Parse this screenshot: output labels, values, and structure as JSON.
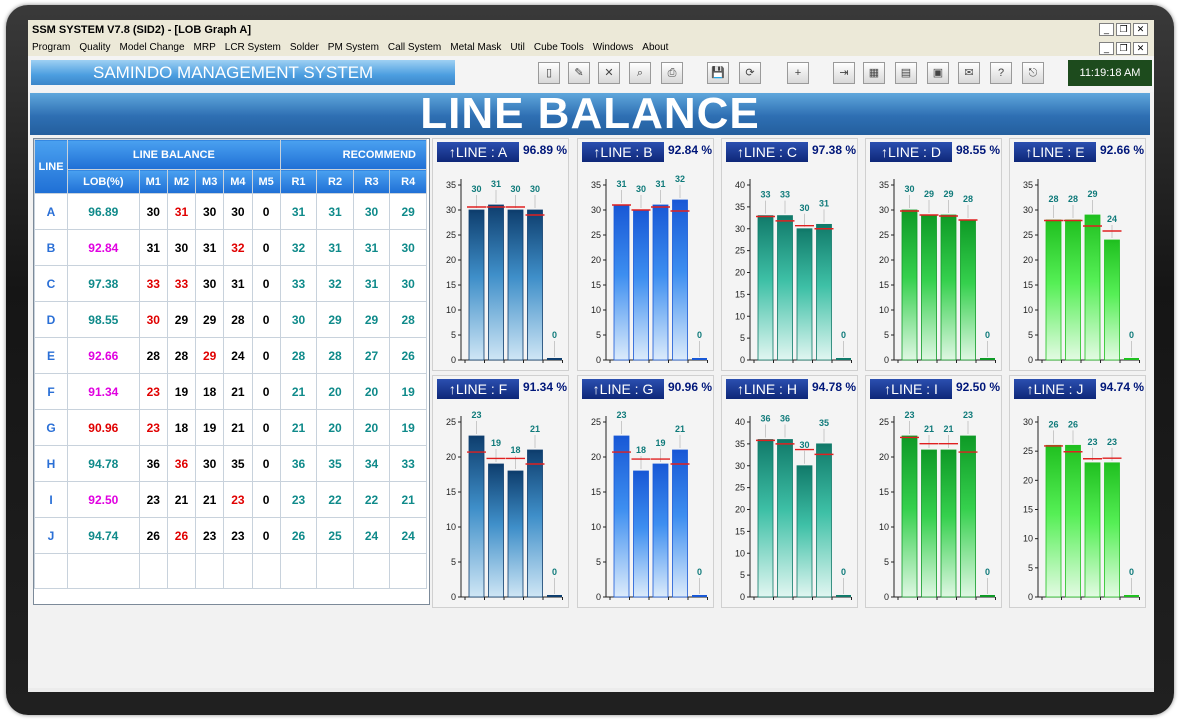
{
  "app": {
    "title": "SSM SYSTEM V7.8 (SID2) - [LOB Graph A]",
    "menu": [
      "Program",
      "Quality",
      "Model Change",
      "MRP",
      "LCR System",
      "Solder",
      "PM System",
      "Call System",
      "Metal Mask",
      "Util",
      "Cube Tools",
      "Windows",
      "About"
    ],
    "system_name": "SAMINDO MANAGEMENT SYSTEM",
    "clock": "11:19:18 AM",
    "page_title": "LINE BALANCE",
    "toolbar_icons": [
      "new-doc-icon",
      "edit-doc-icon",
      "delete-doc-icon",
      "preview-icon",
      "print-icon",
      "save-icon",
      "refresh-icon",
      "add-icon",
      "export-icon",
      "grid-icon",
      "calc-icon",
      "calendar-icon",
      "mail-icon",
      "help-icon",
      "exit-icon"
    ]
  },
  "table": {
    "line_header": "LINE",
    "group_balance": "LINE BALANCE",
    "group_recommend": "RECOMMEND",
    "columns": [
      "LOB(%)",
      "M1",
      "M2",
      "M3",
      "M4",
      "M5",
      "R1",
      "R2",
      "R3",
      "R4"
    ],
    "rows": [
      {
        "line": "A",
        "lob": "96.89",
        "lob_color": "#0f8a8a",
        "m": [
          "30",
          "31",
          "30",
          "30",
          "0"
        ],
        "m_red": [
          false,
          true,
          false,
          false,
          false
        ],
        "r": [
          "31",
          "31",
          "30",
          "29"
        ]
      },
      {
        "line": "B",
        "lob": "92.84",
        "lob_color": "#e000e0",
        "m": [
          "31",
          "30",
          "31",
          "32",
          "0"
        ],
        "m_red": [
          false,
          false,
          false,
          true,
          false
        ],
        "r": [
          "32",
          "31",
          "31",
          "30"
        ]
      },
      {
        "line": "C",
        "lob": "97.38",
        "lob_color": "#0f8a8a",
        "m": [
          "33",
          "33",
          "30",
          "31",
          "0"
        ],
        "m_red": [
          true,
          true,
          false,
          false,
          false
        ],
        "r": [
          "33",
          "32",
          "31",
          "30"
        ]
      },
      {
        "line": "D",
        "lob": "98.55",
        "lob_color": "#0f8a8a",
        "m": [
          "30",
          "29",
          "29",
          "28",
          "0"
        ],
        "m_red": [
          true,
          false,
          false,
          false,
          false
        ],
        "r": [
          "30",
          "29",
          "29",
          "28"
        ]
      },
      {
        "line": "E",
        "lob": "92.66",
        "lob_color": "#e000e0",
        "m": [
          "28",
          "28",
          "29",
          "24",
          "0"
        ],
        "m_red": [
          false,
          false,
          true,
          false,
          false
        ],
        "r": [
          "28",
          "28",
          "27",
          "26"
        ]
      },
      {
        "line": "F",
        "lob": "91.34",
        "lob_color": "#e000e0",
        "m": [
          "23",
          "19",
          "18",
          "21",
          "0"
        ],
        "m_red": [
          true,
          false,
          false,
          false,
          false
        ],
        "r": [
          "21",
          "20",
          "20",
          "19"
        ]
      },
      {
        "line": "G",
        "lob": "90.96",
        "lob_color": "#e00000",
        "m": [
          "23",
          "18",
          "19",
          "21",
          "0"
        ],
        "m_red": [
          true,
          false,
          false,
          false,
          false
        ],
        "r": [
          "21",
          "20",
          "20",
          "19"
        ]
      },
      {
        "line": "H",
        "lob": "94.78",
        "lob_color": "#0f8a8a",
        "m": [
          "36",
          "36",
          "30",
          "35",
          "0"
        ],
        "m_red": [
          false,
          true,
          false,
          false,
          false
        ],
        "r": [
          "36",
          "35",
          "34",
          "33"
        ]
      },
      {
        "line": "I",
        "lob": "92.50",
        "lob_color": "#e000e0",
        "m": [
          "23",
          "21",
          "21",
          "23",
          "0"
        ],
        "m_red": [
          false,
          false,
          false,
          true,
          false
        ],
        "r": [
          "23",
          "22",
          "22",
          "21"
        ]
      },
      {
        "line": "J",
        "lob": "94.74",
        "lob_color": "#0f8a8a",
        "m": [
          "26",
          "26",
          "23",
          "23",
          "0"
        ],
        "m_red": [
          false,
          true,
          false,
          false,
          false
        ],
        "r": [
          "26",
          "25",
          "24",
          "24"
        ]
      }
    ]
  },
  "chart_data": [
    {
      "type": "bar",
      "label": "↑LINE : A",
      "pct": "96.89 %",
      "values": [
        30,
        31,
        30,
        30,
        0
      ],
      "targets": [
        30.6,
        30.6,
        30.6,
        29
      ],
      "ylim": [
        0,
        35
      ],
      "ticks": [
        0,
        5,
        10,
        15,
        20,
        25,
        30,
        35
      ],
      "palette": "navy"
    },
    {
      "type": "bar",
      "label": "↑LINE : B",
      "pct": "92.84 %",
      "values": [
        31,
        30,
        31,
        32,
        0
      ],
      "targets": [
        31,
        30,
        30.6,
        29.8
      ],
      "ylim": [
        0,
        35
      ],
      "ticks": [
        0,
        5,
        10,
        15,
        20,
        25,
        30,
        35
      ],
      "palette": "blue"
    },
    {
      "type": "bar",
      "label": "↑LINE : C",
      "pct": "97.38 %",
      "values": [
        33,
        33,
        30,
        31,
        0
      ],
      "targets": [
        32.8,
        31.8,
        30.7,
        30
      ],
      "ylim": [
        0,
        40
      ],
      "ticks": [
        0,
        5,
        10,
        15,
        20,
        25,
        30,
        35,
        40
      ],
      "palette": "teal"
    },
    {
      "type": "bar",
      "label": "↑LINE : D",
      "pct": "98.55 %",
      "values": [
        30,
        29,
        29,
        28,
        0
      ],
      "targets": [
        29.8,
        29,
        28.8,
        28
      ],
      "ylim": [
        0,
        35
      ],
      "ticks": [
        0,
        5,
        10,
        15,
        20,
        25,
        30,
        35
      ],
      "palette": "green"
    },
    {
      "type": "bar",
      "label": "↑LINE : E",
      "pct": "92.66 %",
      "values": [
        28,
        28,
        29,
        24,
        0
      ],
      "targets": [
        27.9,
        27.9,
        26.8,
        25.8
      ],
      "ylim": [
        0,
        35
      ],
      "ticks": [
        0,
        5,
        10,
        15,
        20,
        25,
        30,
        35
      ],
      "palette": "lime"
    },
    {
      "type": "bar",
      "label": "↑LINE : F",
      "pct": "91.34 %",
      "values": [
        23,
        19,
        18,
        21,
        0
      ],
      "targets": [
        20.7,
        19.8,
        19.8,
        19
      ],
      "ylim": [
        0,
        25
      ],
      "ticks": [
        0,
        5,
        10,
        15,
        20,
        25
      ],
      "palette": "navy"
    },
    {
      "type": "bar",
      "label": "↑LINE : G",
      "pct": "90.96 %",
      "values": [
        23,
        18,
        19,
        21,
        0
      ],
      "targets": [
        20.7,
        19.7,
        19.7,
        19
      ],
      "ylim": [
        0,
        25
      ],
      "ticks": [
        0,
        5,
        10,
        15,
        20,
        25
      ],
      "palette": "blue"
    },
    {
      "type": "bar",
      "label": "↑LINE : H",
      "pct": "94.78 %",
      "values": [
        36,
        36,
        30,
        35,
        0
      ],
      "targets": [
        35.8,
        35,
        33.7,
        32.6
      ],
      "ylim": [
        0,
        40
      ],
      "ticks": [
        0,
        5,
        10,
        15,
        20,
        25,
        30,
        35,
        40
      ],
      "palette": "teal"
    },
    {
      "type": "bar",
      "label": "↑LINE : I",
      "pct": "92.50 %",
      "values": [
        23,
        21,
        21,
        23,
        0
      ],
      "targets": [
        22.8,
        21.9,
        21.9,
        20.7
      ],
      "ylim": [
        0,
        25
      ],
      "ticks": [
        0,
        5,
        10,
        15,
        20,
        25
      ],
      "palette": "green"
    },
    {
      "type": "bar",
      "label": "↑LINE : J",
      "pct": "94.74 %",
      "values": [
        26,
        26,
        23,
        23,
        0
      ],
      "targets": [
        25.9,
        24.9,
        23.7,
        23.8
      ],
      "ylim": [
        0,
        30
      ],
      "ticks": [
        0,
        5,
        10,
        15,
        20,
        25,
        30
      ],
      "palette": "lime"
    }
  ]
}
